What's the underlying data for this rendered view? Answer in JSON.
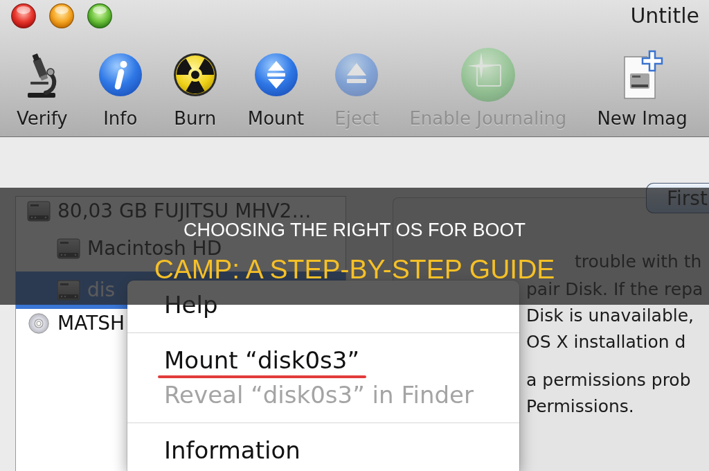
{
  "window": {
    "title": "Untitle"
  },
  "toolbar": {
    "items": [
      {
        "label": "Verify",
        "disabled": false
      },
      {
        "label": "Info",
        "disabled": false
      },
      {
        "label": "Burn",
        "disabled": false
      },
      {
        "label": "Mount",
        "disabled": false
      },
      {
        "label": "Eject",
        "disabled": true
      },
      {
        "label": "Enable Journaling",
        "disabled": true
      },
      {
        "label": "New Imag",
        "disabled": false
      }
    ]
  },
  "sidebar": {
    "items": [
      {
        "label": "80,03 GB FUJITSU MHV2…",
        "kind": "disk",
        "selected": false,
        "children": [
          {
            "label": "Macintosh HD",
            "kind": "disk",
            "selected": false
          },
          {
            "label": "dis",
            "kind": "disk",
            "selected": true
          }
        ]
      },
      {
        "label": "MATSH",
        "kind": "cd",
        "selected": false
      }
    ]
  },
  "panel": {
    "tab": {
      "label": "First",
      "selected": true
    },
    "paragraphs": [
      [
        "trouble with th",
        "pair Disk. If the repa",
        "Disk is unavailable,",
        "OS X installation d"
      ],
      [
        "a permissions prob",
        "Permissions."
      ]
    ]
  },
  "menu": {
    "items": [
      {
        "kind": "item",
        "label": "Help",
        "disabled": false,
        "underlined": false
      },
      {
        "kind": "separator"
      },
      {
        "kind": "item",
        "label": "Mount “disk0s3”",
        "disabled": false,
        "underlined": true
      },
      {
        "kind": "item",
        "label": "Reveal “disk0s3” in Finder",
        "disabled": true,
        "underlined": false
      },
      {
        "kind": "separator"
      },
      {
        "kind": "item",
        "label": "Information",
        "disabled": false,
        "underlined": false
      }
    ]
  },
  "banner": {
    "lines": [
      {
        "text": "CHOOSING THE RIGHT OS FOR BOOT",
        "color": "#ffffff"
      },
      {
        "text": "CAMP: A STEP-BY-STEP GUIDE",
        "color": "#f6c026"
      }
    ]
  }
}
